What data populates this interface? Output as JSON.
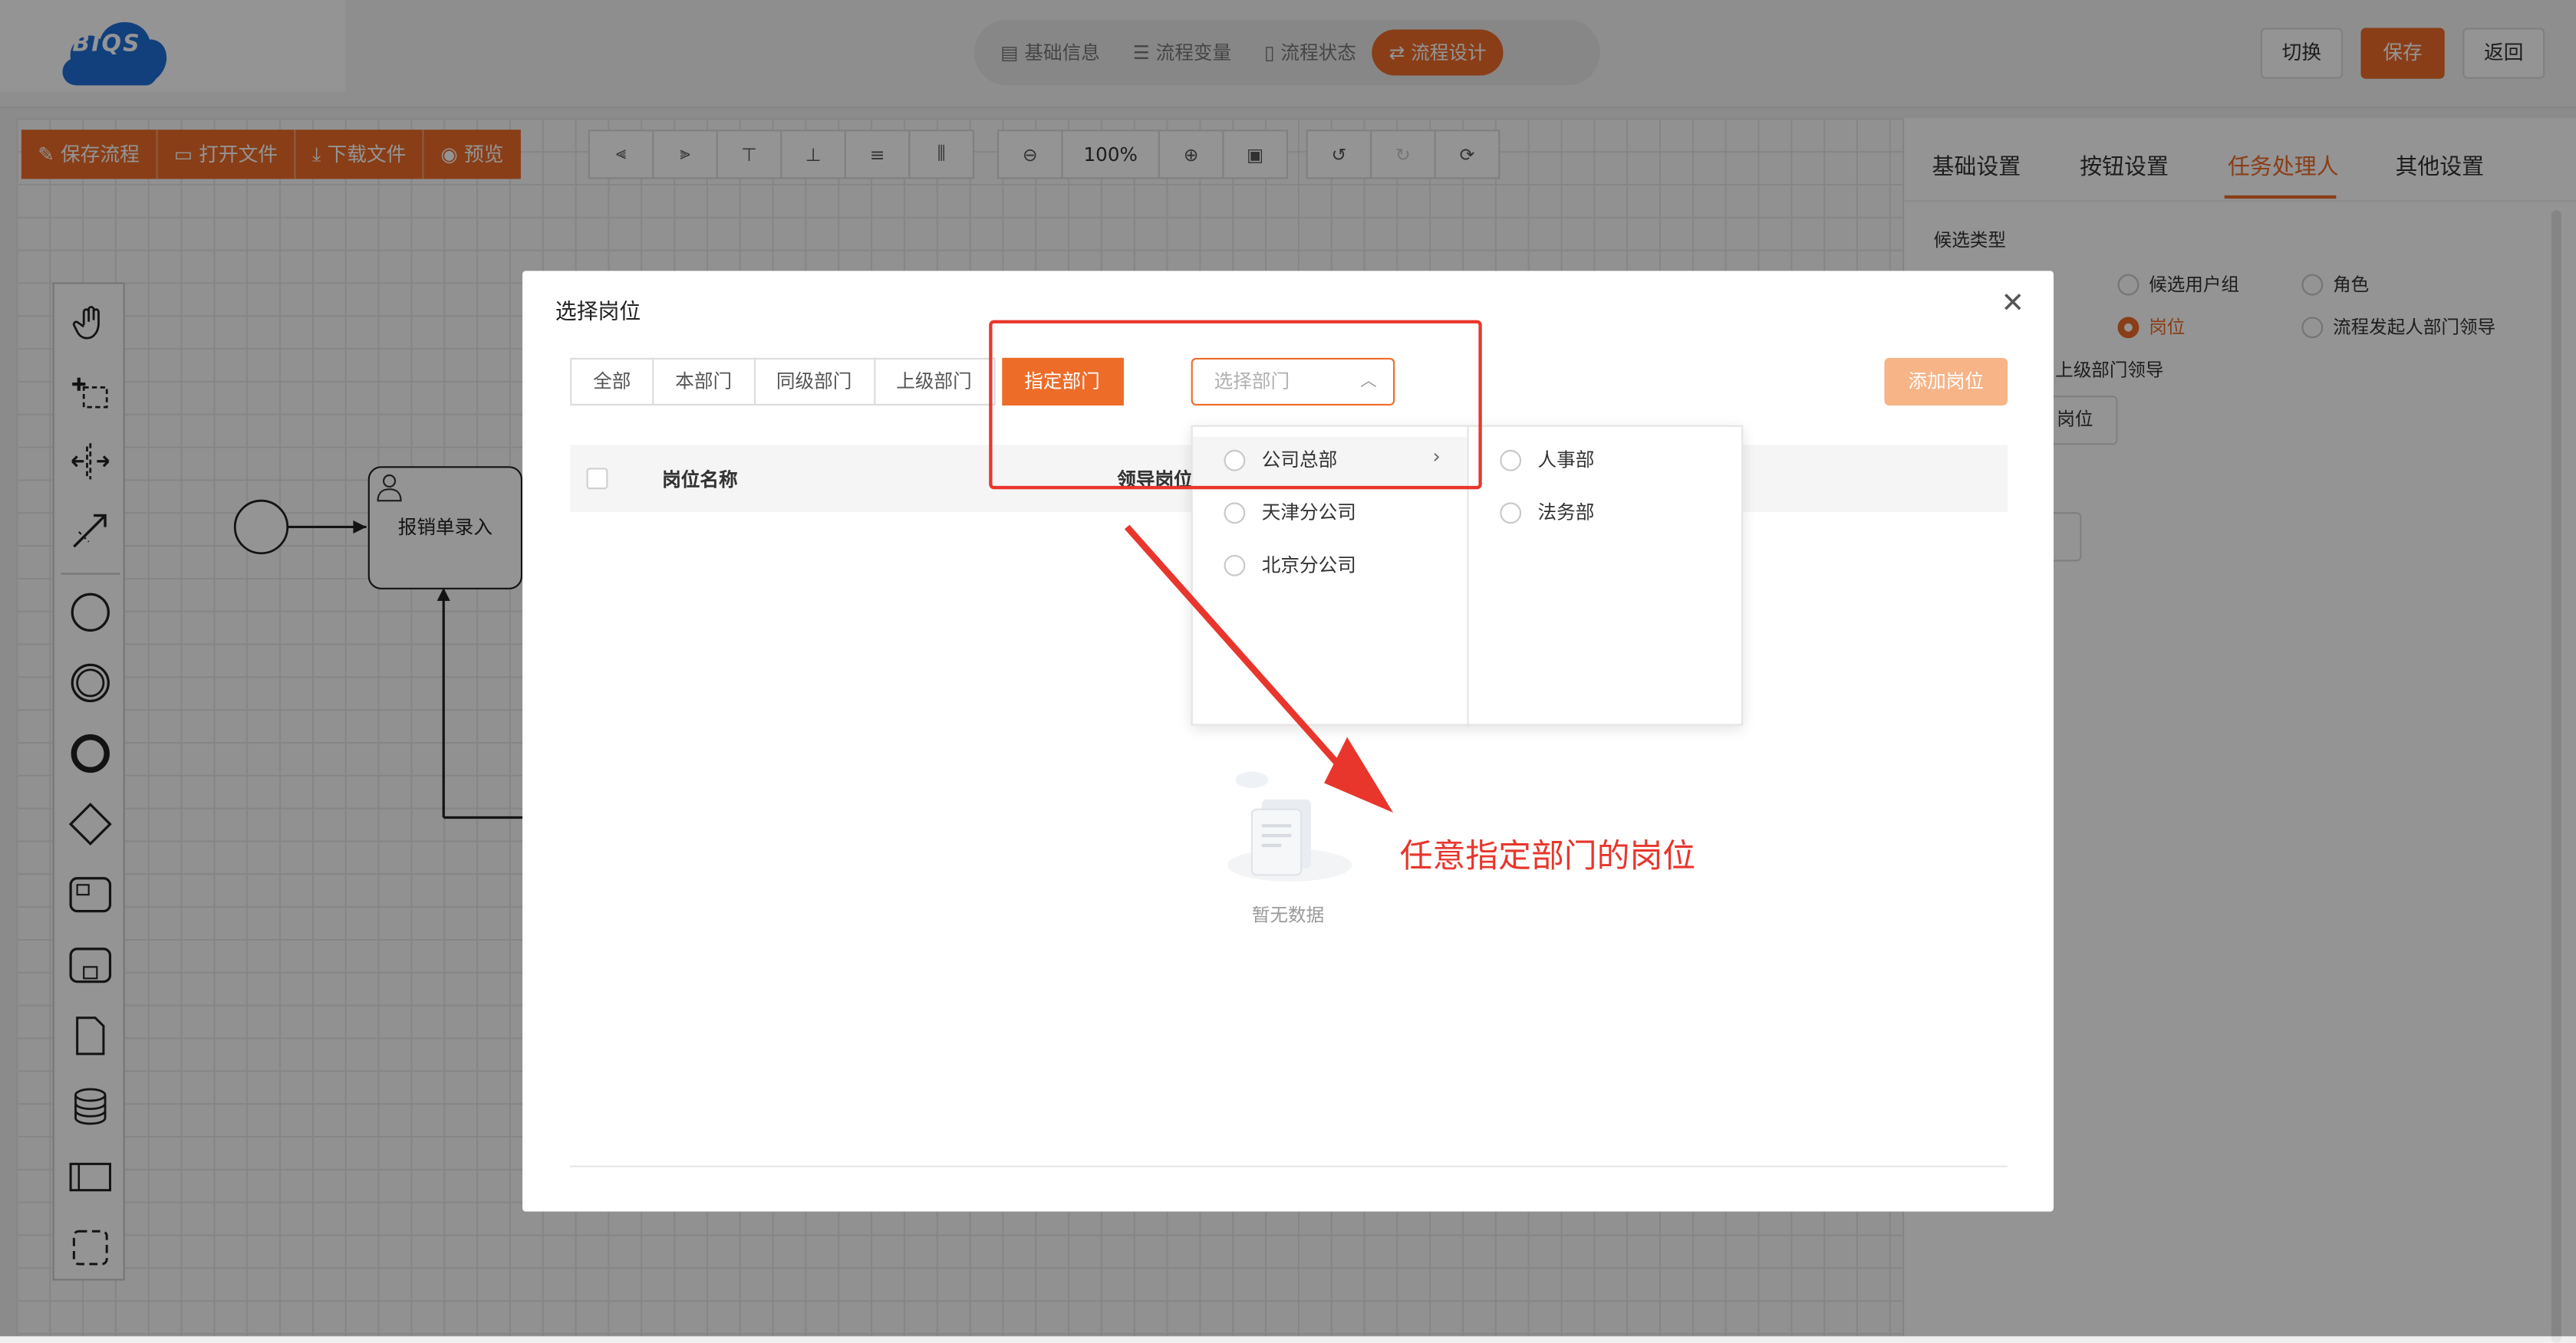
{
  "logo": {
    "text": "BIQS"
  },
  "steps": [
    "基础信息",
    "流程变量",
    "流程状态",
    "流程设计"
  ],
  "top_buttons": {
    "switch": "切换",
    "save": "保存",
    "back": "返回"
  },
  "toolbar": {
    "save_flow": "保存流程",
    "open_file": "打开文件",
    "download_file": "下载文件",
    "preview": "预览",
    "zoom": "100%"
  },
  "diagram": {
    "task_label": "报销单录入"
  },
  "right_panel": {
    "tabs": [
      "基础设置",
      "按钮设置",
      "任务处理人",
      "其他设置"
    ],
    "candidate_type_label": "候选类型",
    "options": [
      "候选用户组",
      "角色",
      "岗位",
      "流程发起人部门领导",
      "上级部门领导"
    ],
    "position_btn": "岗位"
  },
  "dialog": {
    "title": "选择岗位",
    "filters": [
      "全部",
      "本部门",
      "同级部门",
      "上级部门",
      "指定部门"
    ],
    "dept_placeholder": "选择部门",
    "add_button": "添加岗位",
    "columns": [
      "岗位名称",
      "领导岗位"
    ],
    "empty_text": "暂无数据",
    "cascader_left": [
      "公司总部",
      "天津分公司",
      "北京分公司"
    ],
    "cascader_right": [
      "人事部",
      "法务部"
    ]
  },
  "annotation": {
    "text": "任意指定部门的岗位"
  },
  "colors": {
    "accent": "#ed6c28",
    "annotation": "#e8362c"
  }
}
